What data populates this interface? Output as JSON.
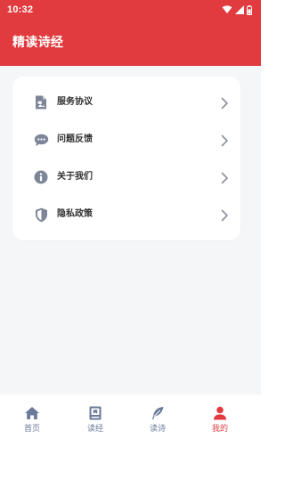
{
  "status_bar": {
    "time": "10:32",
    "icons": [
      "wifi-icon",
      "signal-icon",
      "battery-icon"
    ]
  },
  "header": {
    "title": "精读诗经",
    "background_color": "#e23b3f"
  },
  "menu": {
    "items": [
      {
        "label": "服务协议",
        "icon": "document-icon"
      },
      {
        "label": "问题反馈",
        "icon": "chat-bubble-icon"
      },
      {
        "label": "关于我们",
        "icon": "info-icon"
      },
      {
        "label": "隐私政策",
        "icon": "shield-icon"
      }
    ]
  },
  "bottom_nav": {
    "tabs": [
      {
        "label": "首页",
        "icon": "home-icon",
        "active": false
      },
      {
        "label": "读经",
        "icon": "book-icon",
        "active": false
      },
      {
        "label": "读诗",
        "icon": "feather-icon",
        "active": false
      },
      {
        "label": "我的",
        "icon": "user-icon",
        "active": true
      }
    ],
    "active_color": "#e23b3f",
    "inactive_color": "#6b7a9a"
  }
}
